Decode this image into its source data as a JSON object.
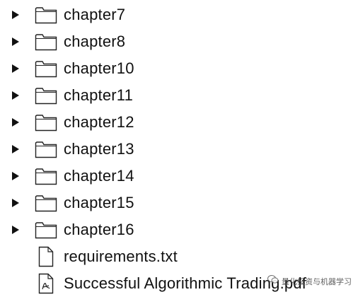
{
  "items": [
    {
      "type": "folder",
      "label": "chapter7",
      "expandable": true
    },
    {
      "type": "folder",
      "label": "chapter8",
      "expandable": true
    },
    {
      "type": "folder",
      "label": "chapter10",
      "expandable": true
    },
    {
      "type": "folder",
      "label": "chapter11",
      "expandable": true
    },
    {
      "type": "folder",
      "label": "chapter12",
      "expandable": true
    },
    {
      "type": "folder",
      "label": "chapter13",
      "expandable": true
    },
    {
      "type": "folder",
      "label": "chapter14",
      "expandable": true
    },
    {
      "type": "folder",
      "label": "chapter15",
      "expandable": true
    },
    {
      "type": "folder",
      "label": "chapter16",
      "expandable": true
    },
    {
      "type": "file",
      "label": "requirements.txt",
      "expandable": false
    },
    {
      "type": "pdf",
      "label": "Successful Algorithmic Trading.pdf",
      "expandable": false
    }
  ],
  "watermark": {
    "text": "量化投资与机器学习"
  }
}
